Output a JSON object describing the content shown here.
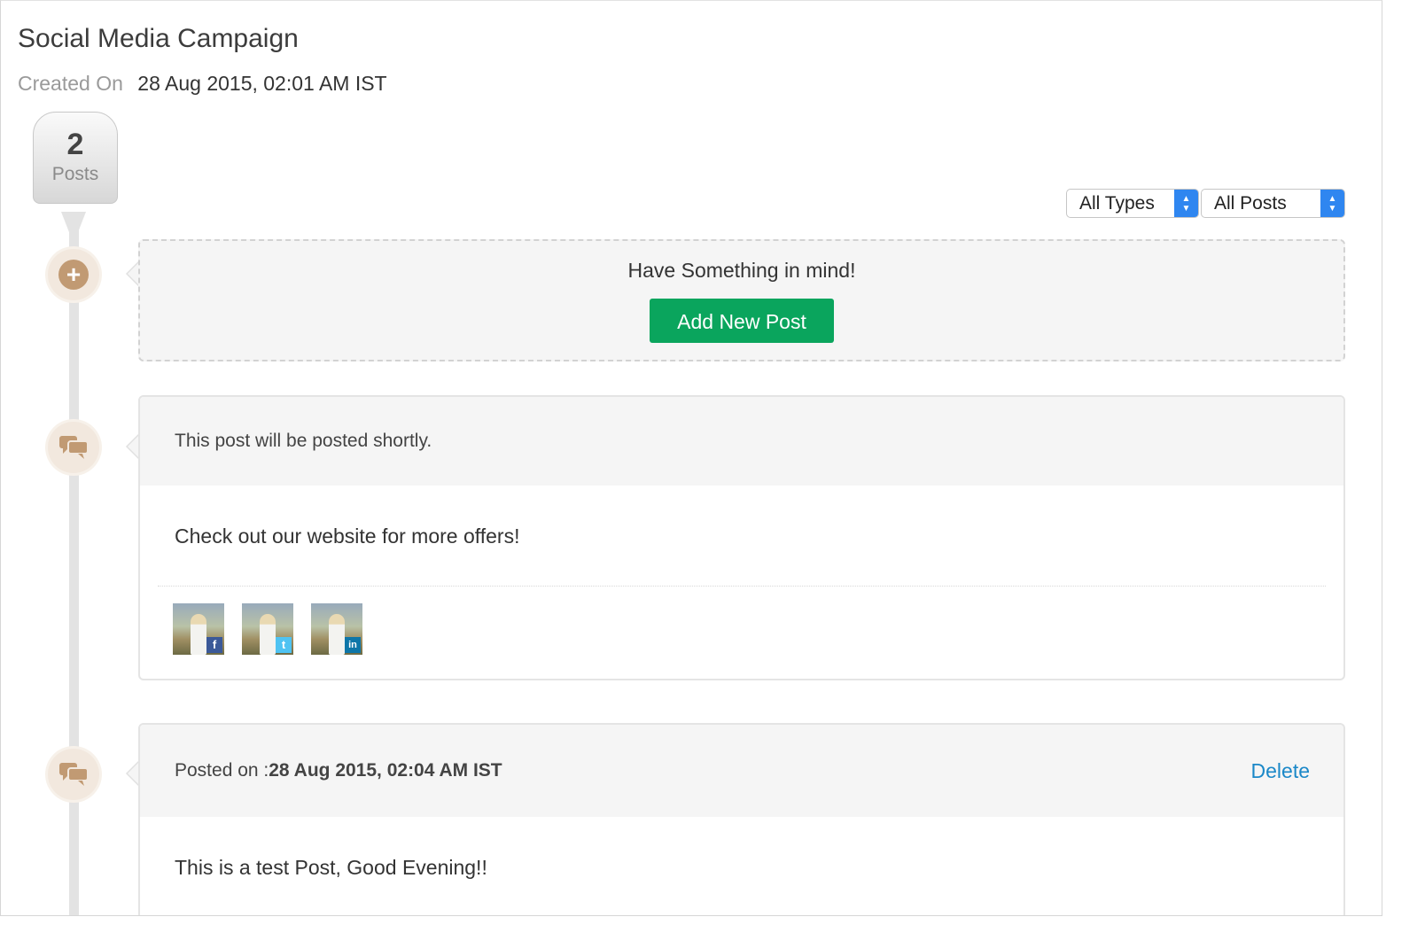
{
  "campaign": {
    "title": "Social Media Campaign",
    "created_label": "Created On",
    "created_value": "28 Aug 2015, 02:01 AM IST"
  },
  "summary": {
    "count": "2",
    "count_label": "Posts"
  },
  "filters": {
    "type_selected": "All Types",
    "posts_selected": "All Posts"
  },
  "compose": {
    "prompt": "Have Something in mind!",
    "button_label": "Add New Post"
  },
  "posts": [
    {
      "status": "This post will be posted shortly.",
      "content": "Check out our website for more offers!",
      "networks": [
        "facebook",
        "twitter",
        "linkedin"
      ]
    },
    {
      "posted_label": "Posted on : ",
      "posted_value": "28 Aug 2015, 02:04 AM IST",
      "delete_label": "Delete",
      "content": "This is a test Post, Good Evening!!"
    }
  ],
  "colors": {
    "accent_green": "#0aa55d",
    "link_blue": "#1b88c8",
    "node_brown": "#c19a73",
    "select_blue": "#2f86f0"
  },
  "icons": {
    "add_node": "plus-circle-icon",
    "post_node": "chat-bubbles-icon",
    "facebook": "facebook-icon",
    "twitter": "twitter-icon",
    "linkedin": "linkedin-icon"
  }
}
